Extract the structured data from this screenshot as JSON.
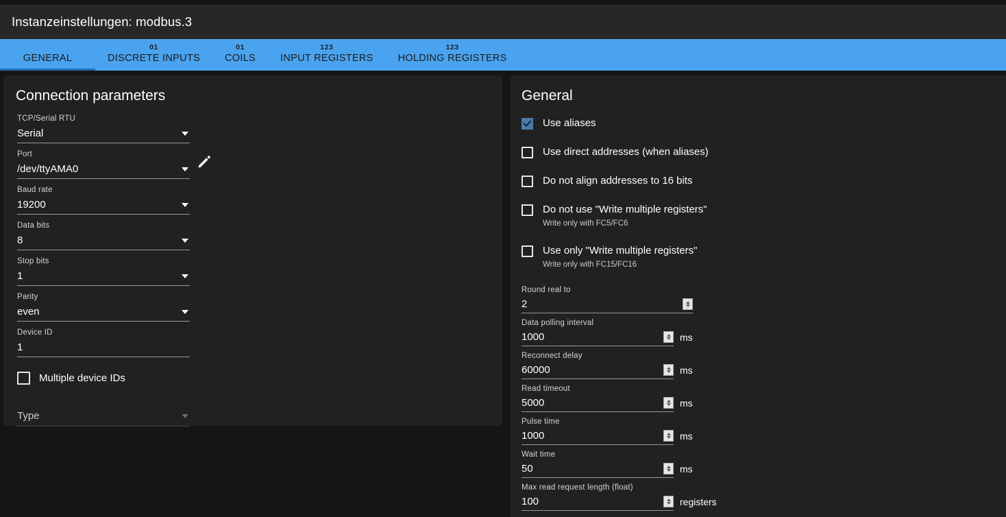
{
  "window": {
    "title": "Instanzeinstellungen: modbus.3"
  },
  "tabs": [
    {
      "num": "",
      "label": "GENERAL",
      "active": true
    },
    {
      "num": "01",
      "label": "DISCRETE INPUTS",
      "active": false
    },
    {
      "num": "01",
      "label": "COILS",
      "active": false
    },
    {
      "num": "123",
      "label": "INPUT REGISTERS",
      "active": false
    },
    {
      "num": "123",
      "label": "HOLDING REGISTERS",
      "active": false
    }
  ],
  "colors": {
    "accent": "#4aa3ef",
    "tab_active_underline": "#1f6fae",
    "checkbox_checked": "#4a7aab",
    "page_bg": "#151515",
    "card_bg": "#212121",
    "titlebar_bg": "#272727"
  },
  "connection": {
    "title": "Connection parameters",
    "fields": [
      {
        "label": "TCP/Serial RTU",
        "value": "Serial",
        "type": "select"
      },
      {
        "label": "Port",
        "value": "/dev/ttyAMA0",
        "type": "select"
      },
      {
        "label": "Baud rate",
        "value": "19200",
        "type": "select"
      },
      {
        "label": "Data bits",
        "value": "8",
        "type": "select"
      },
      {
        "label": "Stop bits",
        "value": "1",
        "type": "select"
      },
      {
        "label": "Parity",
        "value": "even",
        "type": "select"
      },
      {
        "label": "Device ID",
        "value": "1",
        "type": "text"
      }
    ],
    "edit_port_icon": "pencil-icon",
    "multiple_device_ids": {
      "label": "Multiple device IDs",
      "checked": false
    },
    "type_select": {
      "label": "Type",
      "value": "Type",
      "disabled": true
    }
  },
  "general": {
    "title": "General",
    "checkboxes": [
      {
        "label": "Use aliases",
        "sub": "",
        "checked": true
      },
      {
        "label": "Use direct addresses (when aliases)",
        "sub": "",
        "checked": false
      },
      {
        "label": "Do not align addresses to 16 bits",
        "sub": "",
        "checked": false
      },
      {
        "label": "Do not use \"Write multiple registers\"",
        "sub": "Write only with FC5/FC6",
        "checked": false
      },
      {
        "label": "Use only \"Write multiple registers\"",
        "sub": "Write only with FC15/FC16",
        "checked": false
      }
    ],
    "numbers": [
      {
        "label": "Round real to",
        "value": "2",
        "unit": "",
        "wide": true
      },
      {
        "label": "Data polling interval",
        "value": "1000",
        "unit": "ms",
        "wide": false
      },
      {
        "label": "Reconnect delay",
        "value": "60000",
        "unit": "ms",
        "wide": false
      },
      {
        "label": "Read timeout",
        "value": "5000",
        "unit": "ms",
        "wide": false
      },
      {
        "label": "Pulse time",
        "value": "1000",
        "unit": "ms",
        "wide": false
      },
      {
        "label": "Wait time",
        "value": "50",
        "unit": "ms",
        "wide": false
      },
      {
        "label": "Max read request length (float)",
        "value": "100",
        "unit": "registers",
        "wide": false
      }
    ]
  }
}
